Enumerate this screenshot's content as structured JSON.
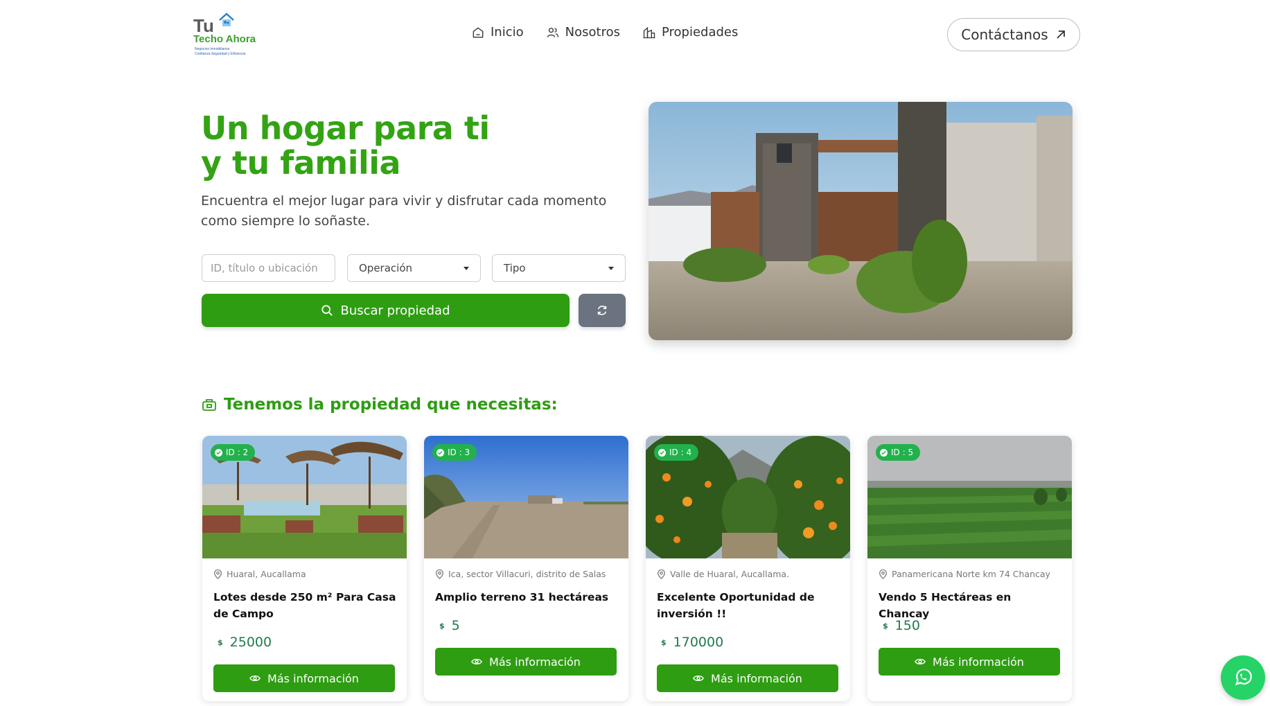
{
  "header": {
    "logo": {
      "tu": "Tu",
      "techo": "Techo Ahora",
      "tagline_1": "Negocios Inmobiliarios",
      "tagline_2": "Confianza Seguridad y Eficiencia"
    },
    "nav": [
      {
        "label": "Inicio",
        "icon": "home-icon"
      },
      {
        "label": "Nosotros",
        "icon": "users-icon"
      },
      {
        "label": "Propiedades",
        "icon": "building-icon"
      }
    ],
    "contact_label": "Contáctanos"
  },
  "hero": {
    "title_line1": "Un hogar para ti",
    "title_line2": "y tu familia",
    "subtitle": "Encuentra el mejor lugar para vivir y disfrutar cada momento como siempre lo soñaste.",
    "search_placeholder": "ID, título o ubicación",
    "operation_label": "Operación",
    "type_label": "Tipo",
    "search_button": "Buscar propiedad"
  },
  "section": {
    "title": "Tenemos la propiedad que necesitas:"
  },
  "properties": [
    {
      "id": "ID : 2",
      "location": "Huaral, Aucallama",
      "title": "Lotes desde 250 m² Para Casa de Campo",
      "currency": "$",
      "price": "25000",
      "button": "Más información"
    },
    {
      "id": "ID : 3",
      "location": "Ica, sector Villacuri, distrito de Salas",
      "title": "Amplio terreno 31 hectáreas",
      "currency": "$",
      "price": "5",
      "button": "Más información"
    },
    {
      "id": "ID : 4",
      "location": "Valle de Huaral, Aucallama.",
      "title": "Excelente Oportunidad de inversión !!",
      "currency": "$",
      "price": "170000",
      "button": "Más información"
    },
    {
      "id": "ID : 5",
      "location": "Panamericana Norte km 74 Chancay",
      "title": "Vendo 5 Hectáreas en Chancay",
      "currency": "$",
      "price": "150",
      "button": "Más información"
    }
  ],
  "colors": {
    "brand_green": "#2e9d12",
    "badge_green": "#22b14c",
    "whatsapp_green": "#25d366",
    "reset_gray": "#6b7280"
  }
}
